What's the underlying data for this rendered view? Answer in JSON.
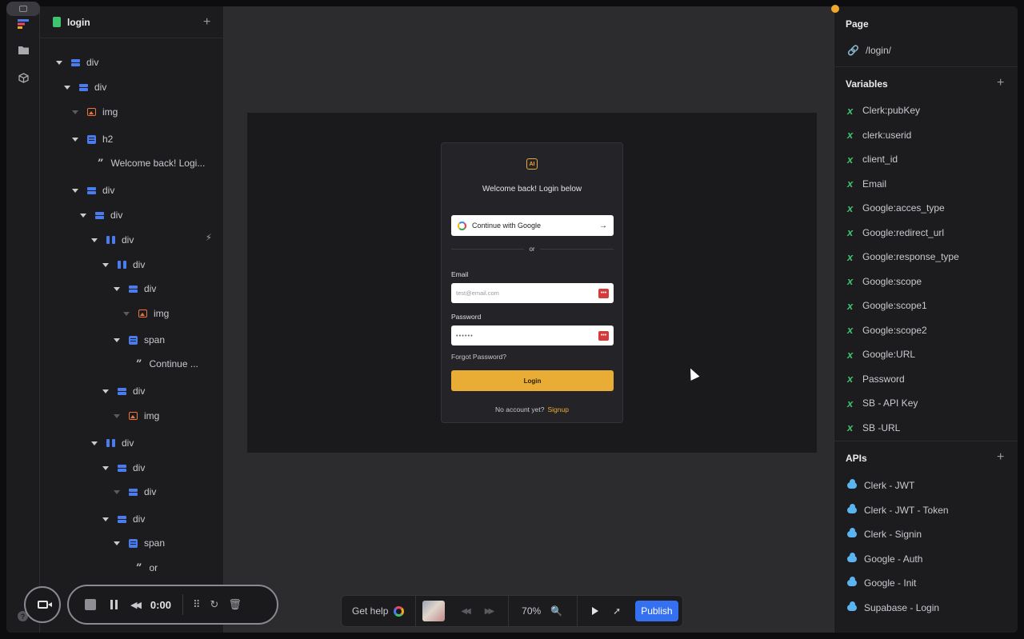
{
  "layers": {
    "page_name": "login",
    "tree": [
      {
        "label": "div",
        "icon": "div",
        "caret": "open"
      },
      {
        "label": "div",
        "icon": "div",
        "caret": "open"
      },
      {
        "label": "img",
        "icon": "img",
        "caret": "dim"
      },
      {
        "label": "h2",
        "icon": "text",
        "caret": "open"
      },
      {
        "label": "Welcome back! Logi...",
        "icon": "quote",
        "caret": "none"
      },
      {
        "label": "div",
        "icon": "div",
        "caret": "open"
      },
      {
        "label": "div",
        "icon": "div",
        "caret": "open"
      },
      {
        "label": "div",
        "icon": "row",
        "caret": "open"
      },
      {
        "label": "div",
        "icon": "row",
        "caret": "open"
      },
      {
        "label": "div",
        "icon": "div",
        "caret": "open"
      },
      {
        "label": "img",
        "icon": "img",
        "caret": "dim"
      },
      {
        "label": "span",
        "icon": "text",
        "caret": "open"
      },
      {
        "label": "Continue ...",
        "icon": "quote",
        "caret": "none"
      },
      {
        "label": "div",
        "icon": "div",
        "caret": "open"
      },
      {
        "label": "img",
        "icon": "img",
        "caret": "dim"
      },
      {
        "label": "div",
        "icon": "row",
        "caret": "open"
      },
      {
        "label": "div",
        "icon": "div",
        "caret": "open"
      },
      {
        "label": "div",
        "icon": "div",
        "caret": "dim"
      },
      {
        "label": "div",
        "icon": "div",
        "caret": "open"
      },
      {
        "label": "span",
        "icon": "text",
        "caret": "open"
      },
      {
        "label": "or",
        "icon": "quote",
        "caret": "none"
      },
      {
        "label": "div",
        "icon": "div",
        "caret": "open"
      }
    ]
  },
  "canvas": {
    "card": {
      "logo": "AI",
      "title": "Welcome back! Login below",
      "google_button": "Continue with Google",
      "google_arrow": "→",
      "or": "or",
      "email_label": "Email",
      "email_placeholder": "test@email.com",
      "password_label": "Password",
      "password_value": "••••••",
      "field_badge": "•••",
      "forgot": "Forgot Password?",
      "login_button": "Login",
      "no_account": "No account yet?",
      "signup": "Signup"
    }
  },
  "right_panel": {
    "page_title": "Page",
    "page_path": "/login/",
    "variables_title": "Variables",
    "variables": [
      "Clerk:pubKey",
      "clerk:userid",
      "client_id",
      "Email",
      "Google:acces_type",
      "Google:redirect_url",
      "Google:response_type",
      "Google:scope",
      "Google:scope1",
      "Google:scope2",
      "Google:URL",
      "Password",
      "SB - API Key",
      "SB -URL"
    ],
    "apis_title": "APIs",
    "apis": [
      "Clerk - JWT",
      "Clerk - JWT - Token",
      "Clerk - Signin",
      "Google - Auth",
      "Google - Init",
      "Supabase - Login"
    ]
  },
  "recorder": {
    "time": "0:00"
  },
  "toolbar": {
    "get_help": "Get help",
    "zoom": "70%",
    "publish": "Publish"
  },
  "colors": {
    "accent": "#e9ad35",
    "publish": "#3570f0",
    "variable": "#3ec46d"
  }
}
